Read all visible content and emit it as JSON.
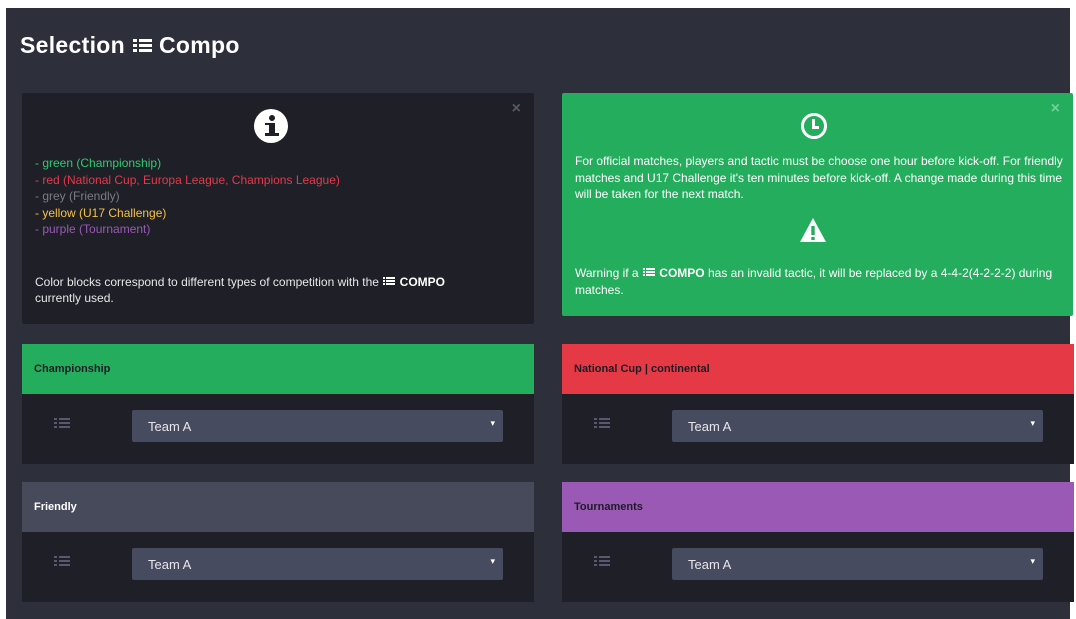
{
  "header": {
    "title_prefix": "Selection",
    "title_suffix": "Compo"
  },
  "colors": {
    "background": "#2d2f3a",
    "panel_dark": "#1e1f27",
    "championship": "#25ad5e",
    "national_cup": "#e63946",
    "friendly": "#474a5a",
    "tournaments": "#9b59b6",
    "legend_green": "#2ecc71",
    "legend_red": "#e53a4a",
    "legend_grey": "#7a7c86",
    "legend_yellow": "#f5c242",
    "legend_purple": "#9b59b6",
    "select_bg": "#474b60"
  },
  "info_panel": {
    "icon": "info-icon",
    "close_label": "×",
    "legend": [
      "- green (Championship)",
      "- red (National Cup, Europa League, Champions League)",
      "- grey (Friendly)",
      "- yellow (U17 Challenge)",
      "- purple (Tournament)"
    ],
    "note_before": "Color blocks correspond to different types of competition with the",
    "note_compo": "COMPO",
    "note_after": "currently used."
  },
  "rules_panel": {
    "icon": "clock-icon",
    "close_label": "×",
    "text": "For official matches, players and tactic must be choose one hour before kick-off. For friendly matches and U17 Challenge it's ten minutes before kick-off. A change made during this time will be taken for the next match.",
    "warning_icon": "warning-icon",
    "warning_before": "Warning if a",
    "warning_compo": "COMPO",
    "warning_after": "has an invalid tactic, it will be replaced by a 4-4-2(4-2-2-2) during matches."
  },
  "cards": {
    "championship": {
      "title": "Championship",
      "selected": "Team A",
      "caret": "▾"
    },
    "national_cup": {
      "title": "National Cup | continental",
      "selected": "Team A",
      "caret": "▾"
    },
    "friendly": {
      "title": "Friendly",
      "selected": "Team A",
      "caret": "▾"
    },
    "tournaments": {
      "title": "Tournaments",
      "selected": "Team A",
      "caret": "▾"
    }
  }
}
